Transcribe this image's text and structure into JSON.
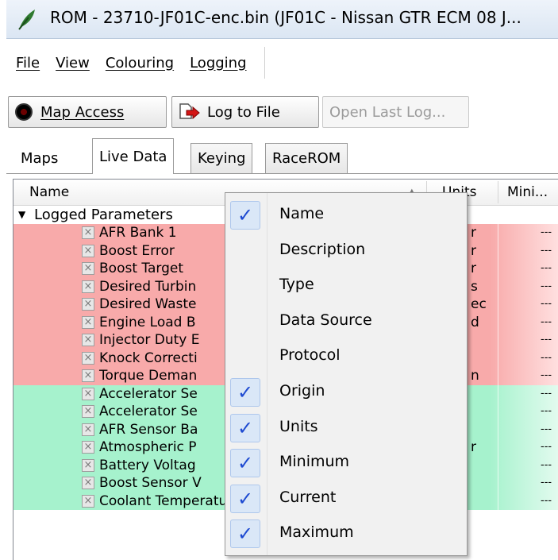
{
  "window": {
    "title": "ROM - 23710-JF01C-enc.bin (JF01C - Nissan GTR ECM 08 J..."
  },
  "menubar": {
    "items": [
      "File",
      "View",
      "Colouring",
      "Logging"
    ]
  },
  "toolbar": {
    "map_access": "Map Access",
    "log_to_file": "Log to File",
    "open_last_log": "Open Last Log..."
  },
  "tabs": [
    "Maps",
    "Live Data",
    "Keying",
    "RaceROM"
  ],
  "grid": {
    "headers": {
      "name": "Name",
      "sort": "▲",
      "units": "Units",
      "minimum": "Mini..."
    },
    "group_label": "Logged Parameters",
    "rows": [
      {
        "name": "AFR Bank 1",
        "unit": "r",
        "min": "---",
        "color": "red"
      },
      {
        "name": "Boost Error",
        "unit": "r",
        "min": "---",
        "color": "red"
      },
      {
        "name": "Boost Target",
        "unit": "r",
        "min": "---",
        "color": "red"
      },
      {
        "name": "Desired Turbin",
        "unit": "s",
        "min": "---",
        "color": "red"
      },
      {
        "name": "Desired Waste",
        "unit": "ec",
        "min": "---",
        "color": "red"
      },
      {
        "name": "Engine Load B",
        "unit": "d",
        "min": "---",
        "color": "red"
      },
      {
        "name": "Injector Duty E",
        "unit": "",
        "min": "---",
        "color": "red"
      },
      {
        "name": "Knock Correcti",
        "unit": "",
        "min": "---",
        "color": "red"
      },
      {
        "name": "Torque Deman",
        "unit": "n",
        "min": "---",
        "color": "red"
      },
      {
        "name": "Accelerator Se",
        "unit": "",
        "min": "---",
        "color": "green"
      },
      {
        "name": "Accelerator Se",
        "unit": "",
        "min": "---",
        "color": "green"
      },
      {
        "name": "AFR Sensor Ba",
        "unit": "",
        "min": "---",
        "color": "green"
      },
      {
        "name": "Atmospheric P",
        "unit": "r",
        "min": "---",
        "color": "green"
      },
      {
        "name": "Battery Voltag",
        "unit": "",
        "min": "---",
        "color": "green"
      },
      {
        "name": "Boost Sensor V",
        "unit": "",
        "min": "---",
        "color": "green"
      },
      {
        "name": "Coolant Temperature",
        "unit": "",
        "min": "---",
        "color": "green"
      }
    ],
    "colors": {
      "red_row": "#f8aaaa",
      "green_row": "#a6f2cd"
    }
  },
  "context_menu": {
    "items": [
      {
        "label": "Name",
        "checked": true
      },
      {
        "label": "Description",
        "checked": false
      },
      {
        "label": "Type",
        "checked": false
      },
      {
        "label": "Data Source",
        "checked": false
      },
      {
        "label": "Protocol",
        "checked": false
      },
      {
        "label": "Origin",
        "checked": true
      },
      {
        "label": "Units",
        "checked": true
      },
      {
        "label": "Minimum",
        "checked": true
      },
      {
        "label": "Current",
        "checked": true
      },
      {
        "label": "Maximum",
        "checked": true
      }
    ],
    "check_glyph": "✓",
    "check_color": "#1e4ad1"
  }
}
